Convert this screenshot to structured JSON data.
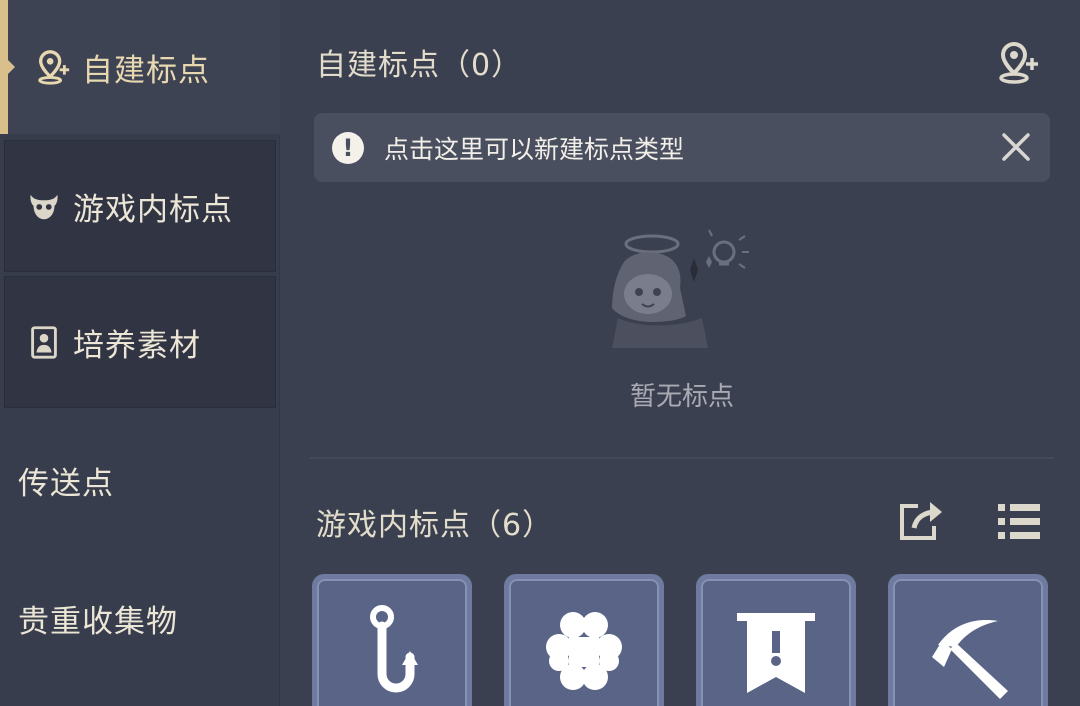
{
  "sidebar": {
    "items": [
      {
        "label": "自建标点",
        "icon": "pin-add-icon",
        "active": true
      },
      {
        "label": "游戏内标点",
        "icon": "game-mark-icon"
      },
      {
        "label": "培养素材",
        "icon": "portrait-icon"
      },
      {
        "label": "传送点"
      },
      {
        "label": "贵重收集物"
      }
    ]
  },
  "custom_section": {
    "title": "自建标点（0）",
    "add_icon": "pin-add-icon",
    "banner_text": "点击这里可以新建标点类型",
    "empty_text": "暂无标点"
  },
  "game_section": {
    "title": "游戏内标点（6）",
    "share_icon": "share-icon",
    "list_icon": "list-icon",
    "tiles": [
      {
        "icon": "fishing-hook-icon"
      },
      {
        "icon": "clover-icon"
      },
      {
        "icon": "banner-alert-icon"
      },
      {
        "icon": "pickaxe-icon"
      }
    ]
  },
  "colors": {
    "accent": "#d8bf8c",
    "background": "#3b4050",
    "tile": "#5a6487"
  }
}
